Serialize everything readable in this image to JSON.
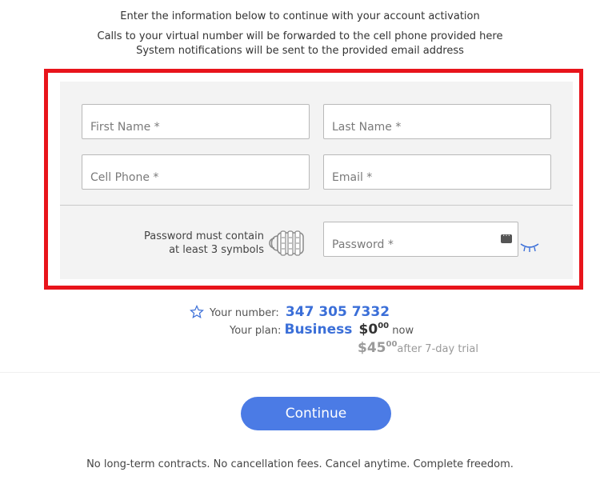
{
  "intro": {
    "line1": "Enter the information below to continue with your account activation",
    "line2": "Calls to your virtual number will be forwarded to the cell phone provided here",
    "line3": "System notifications will be sent to the provided email address"
  },
  "form": {
    "first_name_placeholder": "First Name *",
    "last_name_placeholder": "Last Name *",
    "cell_phone_placeholder": "Cell Phone *",
    "email_placeholder": "Email *",
    "password_hint_line1": "Password must contain",
    "password_hint_line2": "at least 3 symbols",
    "password_placeholder": "Password *"
  },
  "summary": {
    "number_label": "Your number:",
    "number_value": "347 305 7332",
    "plan_label": "Your plan:",
    "plan_name": "Business",
    "price_now_main": "$0",
    "price_now_cents": "00",
    "price_now_suffix": "now",
    "price_later_main": "$45",
    "price_later_cents": "00",
    "price_later_suffix": "after 7-day trial"
  },
  "actions": {
    "continue_label": "Continue"
  },
  "footer": {
    "text": "No long-term contracts. No cancellation fees. Cancel anytime. Complete freedom."
  },
  "colors": {
    "accent": "#4b7be5",
    "highlight_border": "#e8141b",
    "number_blue": "#3b6fd8"
  },
  "icons": [
    "lock-icon",
    "password-manager-icon",
    "eye-icon",
    "star-icon"
  ]
}
